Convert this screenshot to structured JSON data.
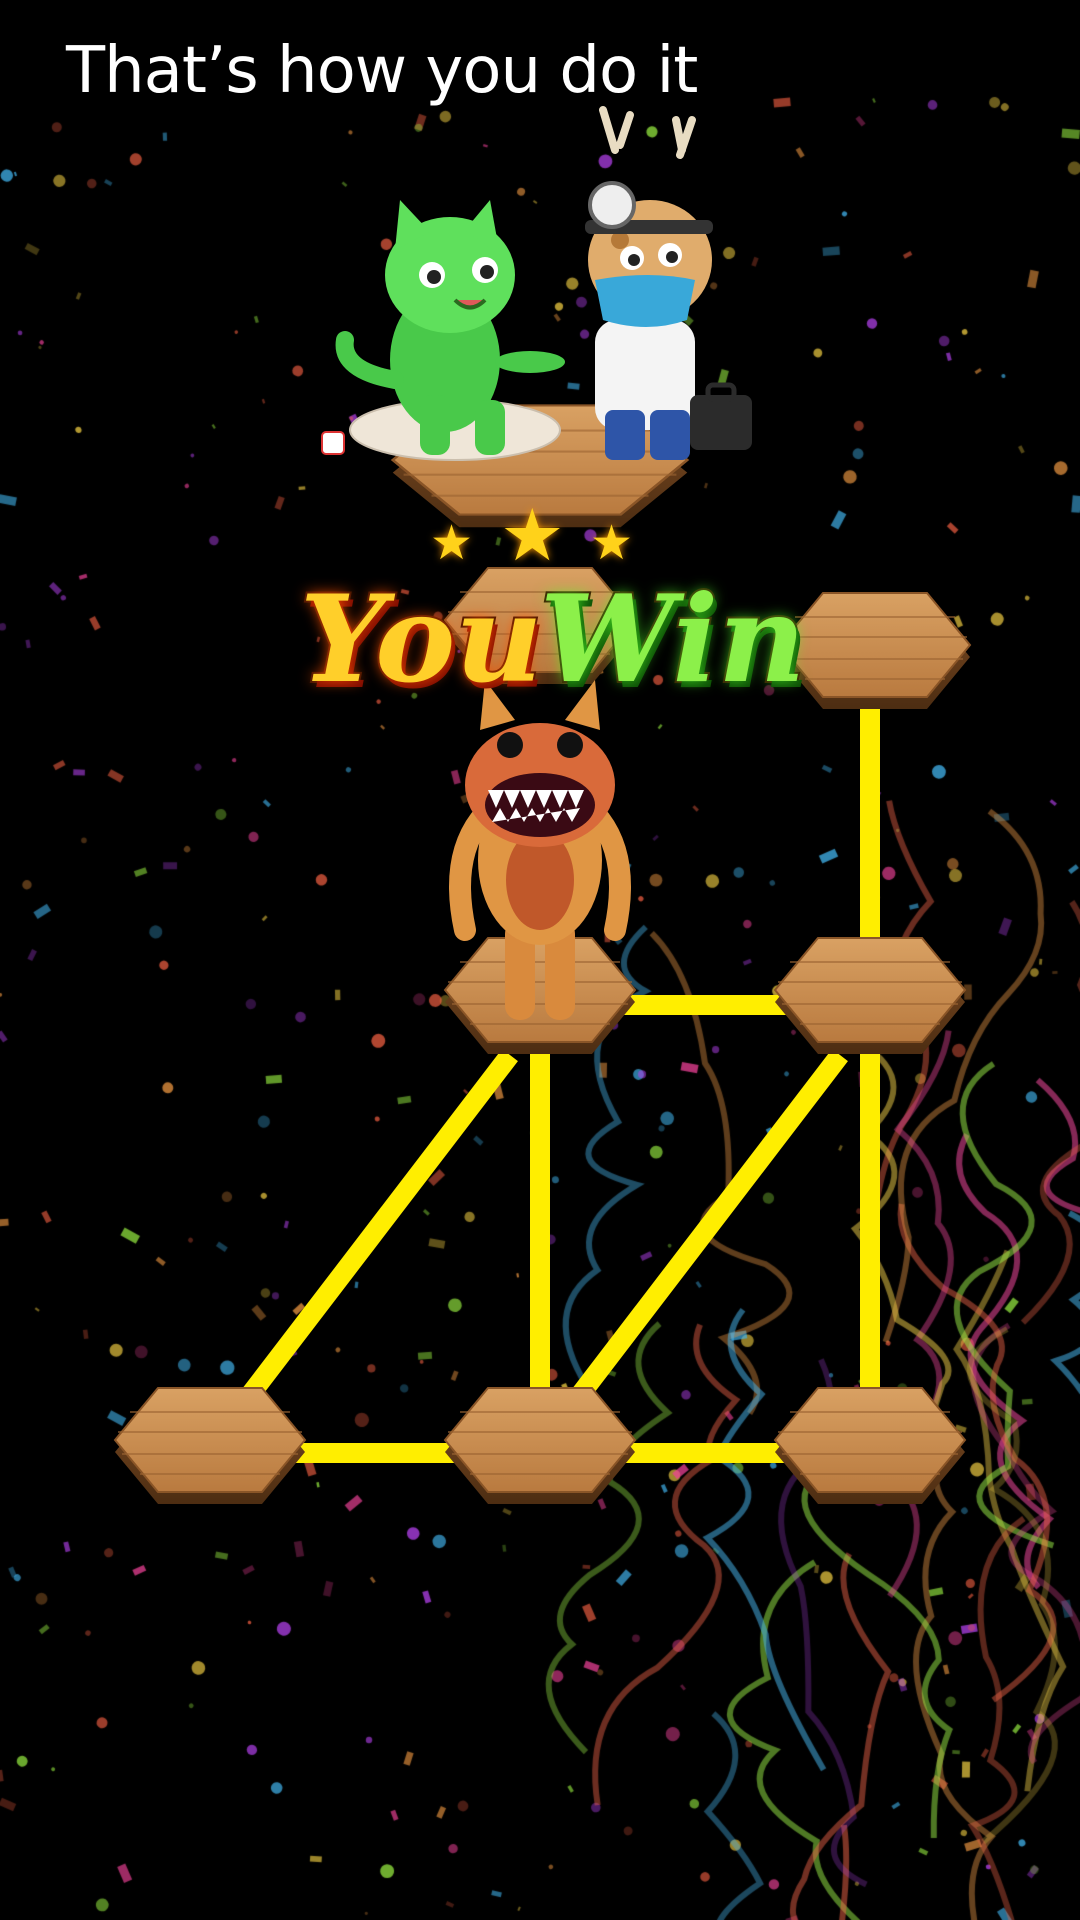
{
  "caption": "That’s how you do it",
  "result": {
    "word1": "You",
    "word2": "Win",
    "stars_earned": 3
  },
  "colors": {
    "background": "#000000",
    "path": "#ffee00",
    "wood": "#c58a4a",
    "you": "#ffcf2a",
    "win": "#8cf04a"
  },
  "characters": {
    "top_scene": [
      "green-cat-patient",
      "giraffe-doctor"
    ],
    "player": "orange-monster"
  },
  "icons": [
    "star-icon",
    "confetti-icon"
  ]
}
